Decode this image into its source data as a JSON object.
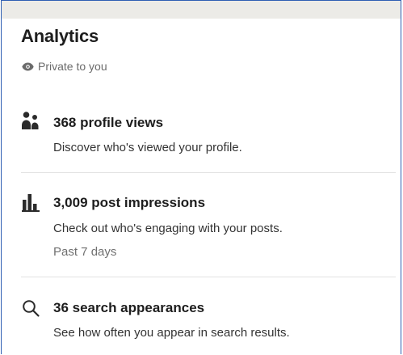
{
  "section": {
    "title": "Analytics",
    "privacy_label": "Private to you"
  },
  "items": [
    {
      "icon": "people-icon",
      "title": "368 profile views",
      "description": "Discover who's viewed your profile."
    },
    {
      "icon": "bar-chart-icon",
      "title": "3,009 post impressions",
      "description": "Check out who's engaging with your posts.",
      "subtext": "Past 7 days"
    },
    {
      "icon": "search-icon",
      "title": "36 search appearances",
      "description": "See how often you appear in search results."
    }
  ],
  "colors": {
    "frame_border": "#2f5fb3",
    "top_strip": "#ecebe7",
    "icon": "#2b2b2b",
    "muted_text": "#6b6b6b"
  }
}
